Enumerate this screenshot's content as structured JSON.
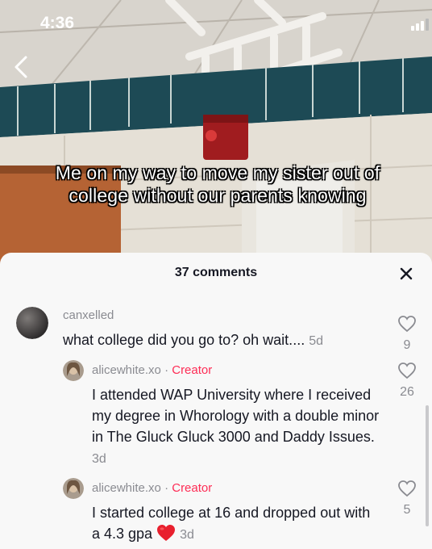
{
  "status_bar": {
    "time": "4:36"
  },
  "video": {
    "caption": "Me on my way to move my sister out of college without our parents knowing"
  },
  "comments_sheet": {
    "title": "37 comments",
    "comments": [
      {
        "username": "canxelled",
        "text": "what college did you go to? oh wait....",
        "time": "5d",
        "likes": "9",
        "is_reply": false
      },
      {
        "username": "alicewhite.xo",
        "badge": "Creator",
        "separator": "·",
        "text": "I attended WAP University where I received my degree in Whorology with a double minor in The Gluck Gluck 3000 and Daddy Issues.",
        "time": "3d",
        "likes": "26",
        "is_reply": true
      },
      {
        "username": "alicewhite.xo",
        "badge": "Creator",
        "separator": "·",
        "text": "I started college at 16 and dropped out with a 4.3 gpa",
        "emoji": "red-heart",
        "time": "3d",
        "likes": "5",
        "is_reply": true
      }
    ]
  },
  "colors": {
    "creator_badge": "#fe2c55",
    "heart_emoji": "#e8202e",
    "sheet_bg": "#f8f8f8"
  }
}
